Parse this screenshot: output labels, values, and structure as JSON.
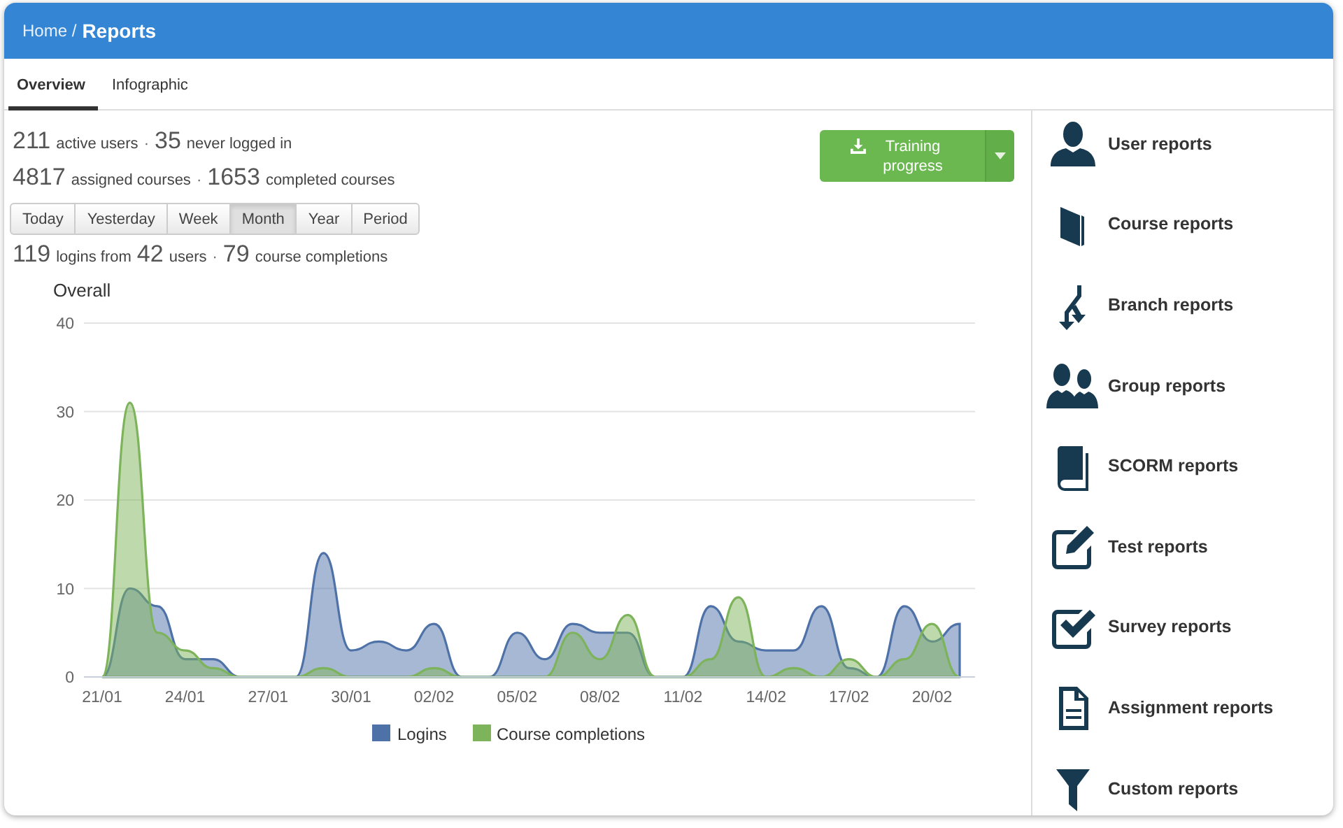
{
  "header": {
    "breadcrumb": "Home /",
    "title": "Reports"
  },
  "tabs": [
    {
      "label": "Overview",
      "selected": true
    },
    {
      "label": "Infographic",
      "selected": false
    }
  ],
  "stats": [
    [
      {
        "kind": "number",
        "text": "211"
      },
      {
        "kind": "label",
        "text": "active users"
      },
      {
        "kind": "sep",
        "text": "·"
      },
      {
        "kind": "number",
        "text": "35"
      },
      {
        "kind": "label",
        "text": "never logged in"
      }
    ],
    [
      {
        "kind": "number",
        "text": "4817"
      },
      {
        "kind": "label",
        "text": "assigned courses"
      },
      {
        "kind": "sep",
        "text": "·"
      },
      {
        "kind": "number",
        "text": "1653"
      },
      {
        "kind": "label",
        "text": "completed courses"
      }
    ]
  ],
  "periods": [
    {
      "label": "Today",
      "selected": false
    },
    {
      "label": "Yesterday",
      "selected": false
    },
    {
      "label": "Week",
      "selected": false
    },
    {
      "label": "Month",
      "selected": true
    },
    {
      "label": "Year",
      "selected": false
    },
    {
      "label": "Period",
      "selected": false
    }
  ],
  "period_stats": [
    {
      "kind": "number",
      "text": "119"
    },
    {
      "kind": "label",
      "text": "logins from"
    },
    {
      "kind": "number",
      "text": "42"
    },
    {
      "kind": "label",
      "text": "users"
    },
    {
      "kind": "sep",
      "text": "·"
    },
    {
      "kind": "number",
      "text": "79"
    },
    {
      "kind": "label",
      "text": "course completions"
    }
  ],
  "export_button": {
    "label": "Training progress"
  },
  "chart_data": {
    "type": "area",
    "title": "Overall",
    "categories": [
      "21/01",
      null,
      null,
      "24/01",
      null,
      null,
      "27/01",
      null,
      null,
      "30/01",
      null,
      null,
      "02/02",
      null,
      null,
      "05/02",
      null,
      null,
      "08/02",
      null,
      null,
      "11/02",
      null,
      null,
      "14/02",
      null,
      null,
      "17/02",
      null,
      null,
      "20/02",
      null
    ],
    "series": [
      {
        "name": "Logins",
        "color": "#4e72a8",
        "values": [
          0,
          10,
          8,
          2,
          2,
          0,
          0,
          0,
          14,
          3,
          4,
          3,
          6,
          0,
          0,
          5,
          2,
          6,
          5,
          5,
          0,
          0,
          8,
          4,
          3,
          3,
          8,
          1,
          0,
          8,
          4,
          6
        ]
      },
      {
        "name": "Course completions",
        "color": "#7db35a",
        "values": [
          0,
          31,
          5,
          3,
          1,
          0,
          0,
          0,
          1,
          0,
          0,
          0,
          1,
          0,
          0,
          0,
          0,
          5,
          2,
          7,
          0,
          0,
          2,
          9,
          0,
          1,
          0,
          2,
          0,
          2,
          6,
          0
        ]
      }
    ],
    "ylim": [
      0,
      40
    ],
    "yticks": [
      0,
      10,
      20,
      30,
      40
    ],
    "stacked": false,
    "grid": true,
    "legend": true
  },
  "report_links": [
    {
      "label": "User reports"
    },
    {
      "label": "Course reports"
    },
    {
      "label": "Branch reports"
    },
    {
      "label": "Group reports"
    },
    {
      "label": "SCORM reports"
    },
    {
      "label": "Test reports"
    },
    {
      "label": "Survey reports"
    },
    {
      "label": "Assignment reports"
    },
    {
      "label": "Custom reports"
    }
  ]
}
